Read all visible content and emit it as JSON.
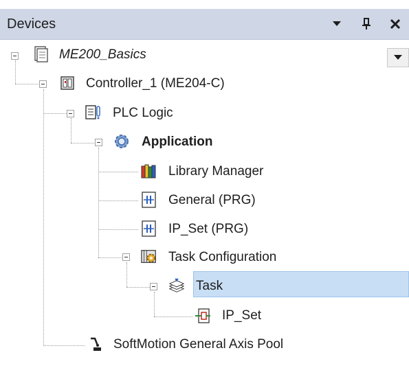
{
  "panel": {
    "title": "Devices",
    "buttons": {
      "menu": "▾",
      "pin": "⊥",
      "close": "✕"
    }
  },
  "tree": {
    "nodes": [
      {
        "label": "ME200_Basics",
        "icon": "project-icon"
      },
      {
        "label": "Controller_1 (ME204-C)",
        "icon": "controller-icon"
      },
      {
        "label": "PLC Logic",
        "icon": "plc-logic-icon"
      },
      {
        "label": "Application",
        "icon": "application-gear-icon"
      },
      {
        "label": "Library Manager",
        "icon": "library-books-icon"
      },
      {
        "label": "General (PRG)",
        "icon": "program-icon"
      },
      {
        "label": "IP_Set (PRG)",
        "icon": "program-icon"
      },
      {
        "label": "Task Configuration",
        "icon": "task-configuration-icon"
      },
      {
        "label": "Task",
        "icon": "task-stack-icon"
      },
      {
        "label": "IP_Set",
        "icon": "program-call-icon"
      },
      {
        "label": "SoftMotion General Axis Pool",
        "icon": "axis-pool-icon"
      }
    ],
    "selected": "IP_Set"
  },
  "colors": {
    "titlebar": "#cfd6e5",
    "selection": "#c8def5",
    "selection_border": "#9cc3ea"
  }
}
